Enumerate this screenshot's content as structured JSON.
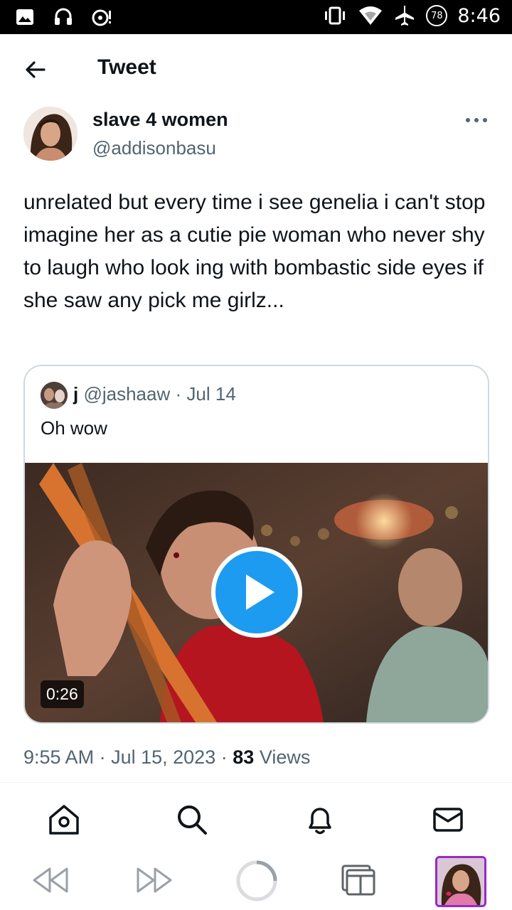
{
  "status_bar": {
    "time": "8:46",
    "battery_level": "78",
    "icons": [
      "image-icon",
      "headset-icon",
      "notification-icon",
      "vibrate-icon",
      "wifi-icon",
      "airplane-icon",
      "battery-icon"
    ]
  },
  "header": {
    "title": "Tweet"
  },
  "tweet": {
    "author_name": "slave 4 women",
    "author_handle": "@addisonbasu",
    "text": "unrelated but every time i see genelia i can't stop imagine her as a cutie pie woman who never shy to laugh who look ing with bombastic side eyes if she saw any pick me girlz...",
    "time": "9:55 AM",
    "date": "Jul 15, 2023",
    "separator": "·",
    "views_count": "83",
    "views_label": "Views"
  },
  "quoted_tweet": {
    "name": "j",
    "handle": "@jashaaw",
    "separator": "·",
    "date": "Jul 14",
    "text": "Oh wow",
    "video_duration": "0:26"
  },
  "bottom_nav": [
    "home-icon",
    "search-icon",
    "notifications-icon",
    "messages-icon"
  ],
  "browser_bar": [
    "back-icon",
    "forward-icon",
    "reload-icon",
    "tabs-icon",
    "profile-thumbnail"
  ],
  "colors": {
    "text_primary": "#0f1419",
    "text_secondary": "#536471",
    "accent": "#1d9bf0",
    "border": "#cfd9de"
  }
}
